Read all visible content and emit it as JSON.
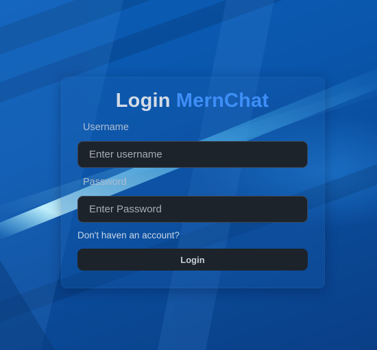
{
  "login": {
    "title_prefix": "Login",
    "title_brand": "MernChat",
    "username_label": "Username",
    "username_placeholder": "Enter username",
    "password_label": "Password",
    "password_placeholder": "Enter Password",
    "signup_link": "Don't haven an account?",
    "submit_label": "Login"
  },
  "colors": {
    "brand": "#3e8ef7",
    "background": "#0a4e9e",
    "input_background": "#1d232a"
  }
}
